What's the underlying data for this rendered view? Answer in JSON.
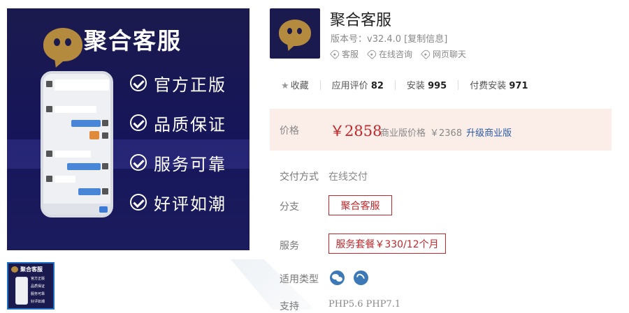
{
  "banner": {
    "title": "聚合客服",
    "features": [
      "官方正版",
      "品质保证",
      "服务可靠",
      "好评如潮"
    ]
  },
  "thumbnail": {
    "title": "聚合客服",
    "features": [
      "官方正版",
      "品质保证",
      "服务可靠",
      "好评如潮"
    ]
  },
  "product": {
    "name": "聚合客服",
    "version": "版本号：v32.4.0 [复制信息]",
    "tags": [
      "客服",
      "在线咨询",
      "网页聊天"
    ]
  },
  "stats": {
    "favorite_label": "收藏",
    "rating_label": "应用评价",
    "rating_value": "82",
    "install_label": "安装",
    "install_value": "995",
    "paid_label": "付费安装",
    "paid_value": "971"
  },
  "price": {
    "label": "价格",
    "main": "￥2858",
    "business_label": "商业版价格",
    "business_value": "￥2368",
    "upgrade": "升级商业版"
  },
  "delivery": {
    "label": "交付方式",
    "value": "在线交付"
  },
  "branch": {
    "label": "分支",
    "option": "聚合客服"
  },
  "service": {
    "label": "服务",
    "option": "服务套餐￥330/12个月"
  },
  "platform": {
    "label": "适用类型",
    "icons": [
      "wechat-icon",
      "mini-program-icon"
    ]
  },
  "support": {
    "label": "支持",
    "value": "PHP5.6 PHP7.1"
  },
  "colors": {
    "accent_red": "#c3272b",
    "banner_bg": "#1b1a4e",
    "price_bg": "#fbeee9",
    "link_blue": "#2a5aa8"
  }
}
